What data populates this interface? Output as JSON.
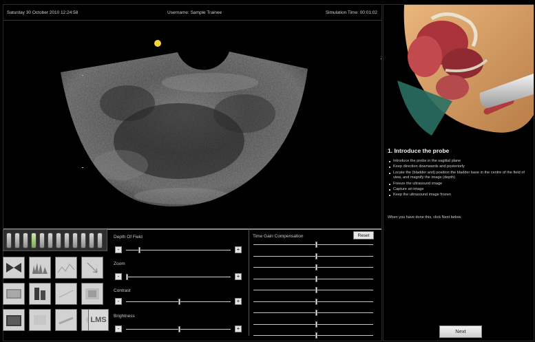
{
  "status_bar": {
    "datetime": "Saturday 30 October 2010 12:24:58",
    "username": "Username: Sample Trainee",
    "simulation_time": "Simulation Time: 00:01:02"
  },
  "controls": {
    "presets_count": 12,
    "active_preset_index": 3,
    "tools": [
      "bowtie-icon",
      "spectrum-icon",
      "waveform-icon",
      "arrow-icon",
      "grid-icon",
      "bars-icon",
      "film-icon",
      "texture-icon",
      "scan-icon",
      "folder-icon",
      "image-icon",
      "image-icon",
      "image-icon",
      "lms-icon"
    ],
    "lms_label": "LMS",
    "sliders": [
      {
        "label": "Depth Of Field",
        "minus": "-",
        "plus": "+",
        "level_percent": 12
      },
      {
        "label": "Zoom",
        "minus": "-",
        "plus": "+",
        "level_percent": 0
      },
      {
        "label": "Contrast",
        "minus": "-",
        "plus": "+",
        "level_percent": 50
      },
      {
        "label": "Brightness",
        "minus": "-",
        "plus": "+",
        "level_percent": 50
      }
    ],
    "tgc": {
      "label": "Time Gain Compensation",
      "reset": "Reset",
      "levels_percent": [
        52,
        52,
        52,
        52,
        52,
        52,
        52,
        52,
        52
      ]
    }
  },
  "instructions": {
    "title": "1. Introduce the probe",
    "steps": [
      "Introduce the probe in the sagittal plane",
      "Keep direction downwards and posteriorly",
      "Locate the (bladder and) position the bladder base in the centre of the field of view, and magnify the image (depth)",
      "Freeze the ultrasound image",
      "Capture an image",
      "Keep the ultrasound image frozen"
    ],
    "note": "When you have done this, click Next below.",
    "next": "Next"
  },
  "colors": {
    "background": "#000000",
    "marker": "#f2d33a",
    "active_preset": "#8fc064",
    "skin": "#d9a36a"
  }
}
